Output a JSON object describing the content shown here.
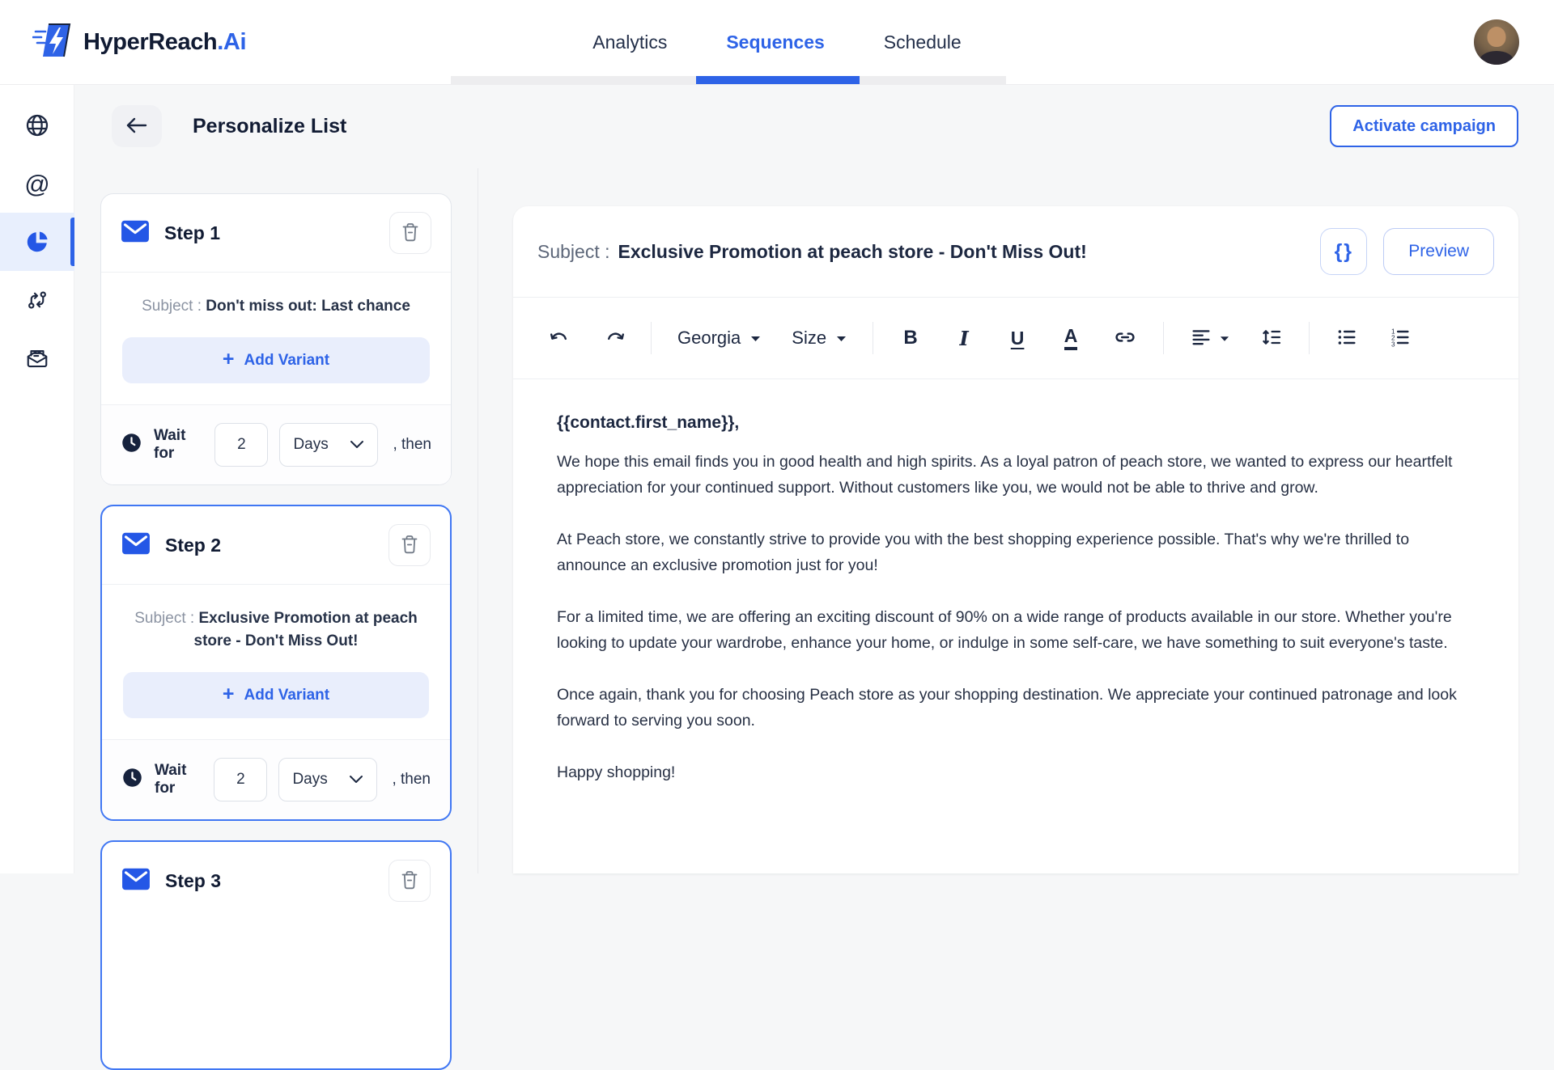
{
  "brand": {
    "name": "HyperReach",
    "suffix": ".Ai"
  },
  "nav": {
    "tabs": [
      {
        "label": "Analytics",
        "active": false
      },
      {
        "label": "Sequences",
        "active": true
      },
      {
        "label": "Schedule",
        "active": false
      }
    ]
  },
  "sidebar": {
    "items": [
      {
        "icon": "globe",
        "active": false
      },
      {
        "icon": "at-sign",
        "active": false
      },
      {
        "icon": "pie-chart",
        "active": true
      },
      {
        "icon": "git-compare",
        "active": false
      },
      {
        "icon": "mail-open",
        "active": false
      }
    ]
  },
  "page": {
    "title": "Personalize List",
    "activate_button": "Activate campaign"
  },
  "ui": {
    "plus": "+",
    "at_glyph": "@",
    "braces": "{}"
  },
  "steps": [
    {
      "title": "Step 1",
      "subject_label": "Subject :",
      "subject": "Don't miss out: Last chance",
      "add_variant_label": "Add Variant",
      "wait": {
        "prefix": "Wait for",
        "value": "2",
        "unit": "Days",
        "suffix": ", then"
      },
      "selected": false
    },
    {
      "title": "Step 2",
      "subject_label": "Subject :",
      "subject": "Exclusive Promotion at peach store - Don't Miss Out!",
      "add_variant_label": "Add Variant",
      "wait": {
        "prefix": "Wait for",
        "value": "2",
        "unit": "Days",
        "suffix": ", then"
      },
      "selected": true
    },
    {
      "title": "Step 3",
      "selected": true
    }
  ],
  "editor": {
    "subject_label": "Subject :",
    "subject": "Exclusive Promotion at peach store - Don't Miss Out!",
    "preview_button": "Preview",
    "toolbar": {
      "font_family": "Georgia",
      "size_label": "Size",
      "bold": "B",
      "italic": "I",
      "underline": "U",
      "text_color": "A"
    },
    "body": {
      "greeting": "{{contact.first_name}},",
      "paragraphs": [
        "We hope this email finds you in good health and high spirits. As a loyal patron of peach store, we wanted to express our heartfelt appreciation for your continued support. Without customers like you, we would not be able to thrive and grow.",
        "At Peach store, we constantly strive to provide you with the best shopping experience possible. That's why we're thrilled to announce an exclusive promotion just for you!",
        "For a limited time, we are offering an exciting discount of 90% on a wide range of products available in our store. Whether you're looking to update your wardrobe, enhance your home, or indulge in some self-care, we have something to suit everyone's taste.",
        "Once again, thank you for choosing Peach store as your shopping destination. We appreciate your continued patronage and look forward to serving you soon.",
        "Happy shopping!"
      ]
    }
  },
  "colors": {
    "accent": "#2e63e7",
    "accent_light": "#e9eefc",
    "selected_border": "#4077f3",
    "text_dark": "#1c2740",
    "text_gray": "#8b93a2"
  }
}
